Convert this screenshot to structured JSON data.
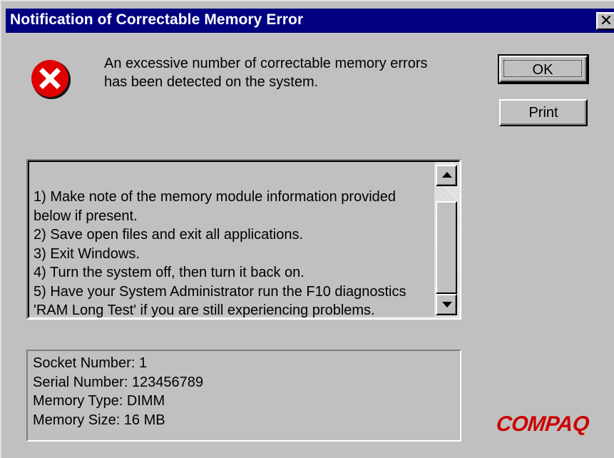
{
  "window": {
    "title": "Notification of Correctable Memory Error",
    "close_glyph": "✕"
  },
  "icons": {
    "error": "error-x-icon",
    "close": "close-icon",
    "scroll_up": "arrow-up-icon",
    "scroll_down": "arrow-down-icon"
  },
  "message": {
    "lines": [
      "An excessive number of correctable memory errors",
      "has been detected on the system."
    ]
  },
  "buttons": {
    "ok_label": "OK",
    "print_label": "Print"
  },
  "instructions": {
    "lines": [
      "1) Make note of the memory module information provided",
      "below if present.",
      "2) Save open files and exit all applications.",
      "3) Exit Windows.",
      "4) Turn the system off, then turn it back on.",
      "5) Have your System Administrator run the F10 diagnostics",
      "'RAM Long Test' if you are still experiencing problems."
    ]
  },
  "memory_info": {
    "lines": [
      "Socket Number: 1",
      "Serial Number: 123456789",
      "Memory Type: DIMM",
      "Memory Size: 16 MB"
    ]
  },
  "brand": {
    "logo_text": "COMPAQ"
  },
  "colors": {
    "titlebar": "#000080",
    "dialog_face": "#c0c0c0",
    "error_icon": "#e00000",
    "brand": "#cc0000"
  }
}
